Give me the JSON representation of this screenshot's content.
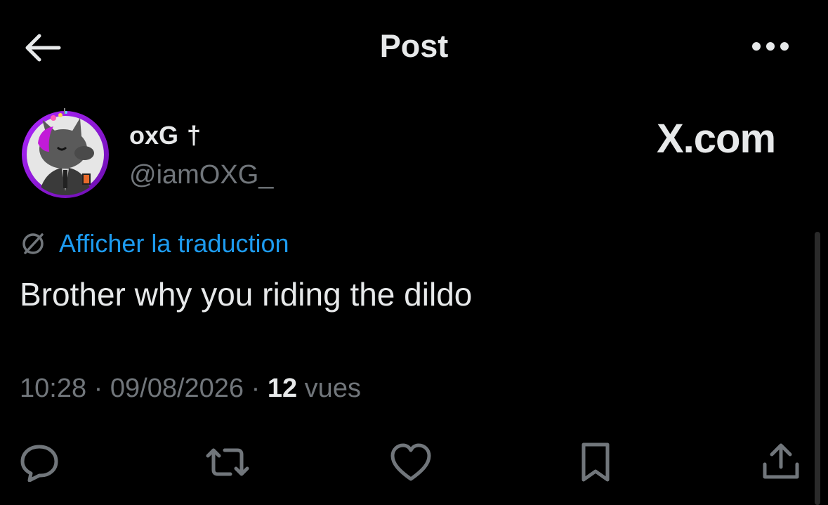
{
  "header": {
    "title": "Post",
    "back_icon": "arrow-left-icon",
    "more_icon": "ellipsis-icon"
  },
  "author": {
    "display_name": "oxG",
    "name_symbol": "†",
    "handle": "@iamOXG_",
    "avatar_icon": "avatar-image",
    "avatar_ring_color": "#8a2be2"
  },
  "watermark": "X.com",
  "translation": {
    "label": "Afficher la traduction",
    "icon": "translate-globe-icon",
    "color": "#1d9bf0"
  },
  "post": {
    "text": "Brother why you riding the dildo"
  },
  "meta": {
    "time": "10:28",
    "separator_1": " · ",
    "date": "09/08/2026",
    "separator_2": " · ",
    "views_count": "12",
    "views_label": " vues"
  },
  "actions": [
    {
      "name": "reply",
      "icon": "reply-icon"
    },
    {
      "name": "repost",
      "icon": "repost-icon"
    },
    {
      "name": "like",
      "icon": "heart-icon"
    },
    {
      "name": "bookmark",
      "icon": "bookmark-icon"
    },
    {
      "name": "share",
      "icon": "share-icon"
    }
  ],
  "colors": {
    "background": "#000000",
    "text_primary": "#e7e9ea",
    "text_secondary": "#71767b",
    "accent": "#1d9bf0"
  }
}
